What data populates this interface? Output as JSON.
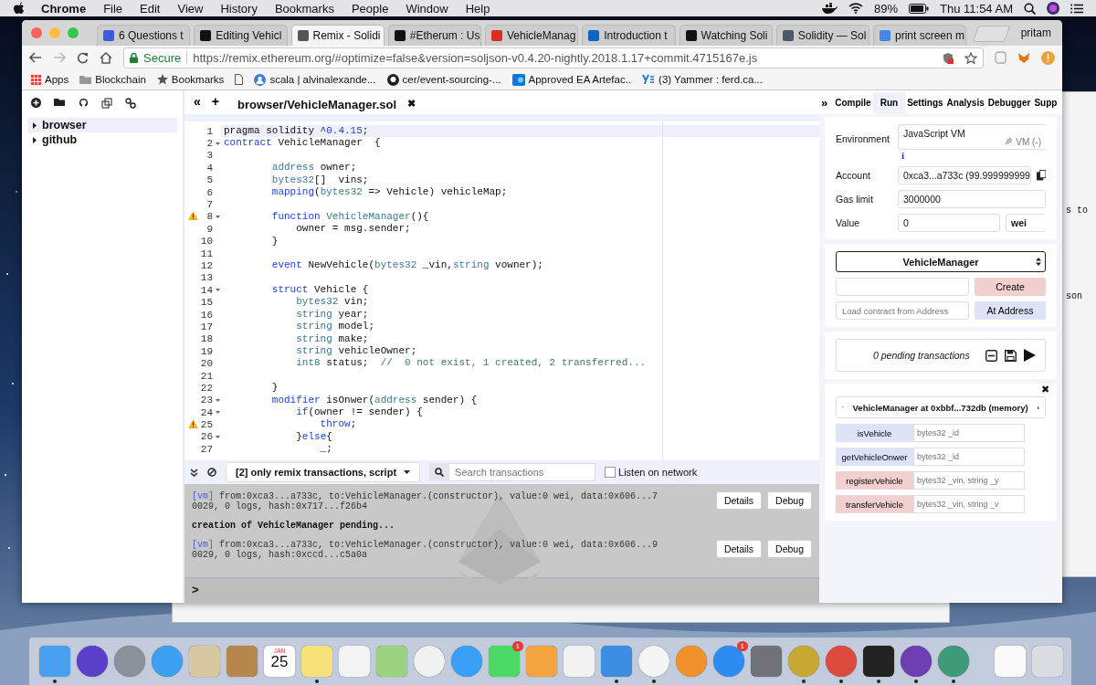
{
  "menubar": {
    "app": "Chrome",
    "menus": [
      "File",
      "Edit",
      "View",
      "History",
      "Bookmarks",
      "People",
      "Window",
      "Help"
    ],
    "battery": "89%",
    "clock": "Thu 11:54 AM"
  },
  "browser": {
    "tabs": [
      {
        "title": "6 Questions t",
        "selected": false,
        "color": "#3b5bdb"
      },
      {
        "title": "Editing Vehicl",
        "selected": false,
        "color": "#111111"
      },
      {
        "title": "Remix - Solidi",
        "selected": true,
        "color": "#555555"
      },
      {
        "title": "#Etherum : Us",
        "selected": false,
        "color": "#111111"
      },
      {
        "title": "VehicleManag",
        "selected": false,
        "color": "#d93025"
      },
      {
        "title": "Introduction t",
        "selected": false,
        "color": "#0a66c2"
      },
      {
        "title": "Watching Soli",
        "selected": false,
        "color": "#111111"
      },
      {
        "title": "Solidity — Sol",
        "selected": false,
        "color": "#4a5a6a"
      },
      {
        "title": "print screen m",
        "selected": false,
        "color": "#4285f4"
      }
    ],
    "profile": "pritam",
    "secure": "Secure",
    "url": "https://remix.ethereum.org/#optimize=false&version=soljson-v0.4.20-nightly.2018.1.17+commit.4715167e.js",
    "bookmarks": [
      {
        "kind": "apps",
        "label": "Apps"
      },
      {
        "kind": "folder",
        "label": "Blockchain"
      },
      {
        "kind": "star",
        "label": "Bookmarks"
      },
      {
        "kind": "page"
      },
      {
        "kind": "avatar",
        "label": "scala | alvinalexande..."
      },
      {
        "kind": "github",
        "label": "cer/event-sourcing-..."
      },
      {
        "kind": "sharepoint",
        "label": "Approved EA Artefac.."
      },
      {
        "kind": "yammer",
        "label": "(3) Yammer : ferd.ca..."
      }
    ]
  },
  "remix": {
    "files": [
      {
        "label": "browser",
        "selected": true
      },
      {
        "label": "github",
        "selected": false
      }
    ],
    "editor": {
      "collapse": "«",
      "add": "+",
      "file": "browser/VehicleManager.sol",
      "close": "✖",
      "lines": [
        {
          "number": "1",
          "warning": false,
          "fold": false,
          "active": true,
          "tokens": [
            {
              "kind": "plain",
              "text": "pragma solidity ^"
            },
            {
              "kind": "number",
              "text": "0.4.15"
            },
            {
              "kind": "plain",
              "text": ";"
            }
          ]
        },
        {
          "number": "2",
          "warning": false,
          "fold": true,
          "active": false,
          "tokens": [
            {
              "kind": "keyword",
              "text": "contract"
            },
            {
              "kind": "plain",
              "text": " VehicleManager  {"
            }
          ]
        },
        {
          "number": "3",
          "warning": false,
          "fold": false,
          "active": false
        },
        {
          "number": "4",
          "warning": false,
          "fold": false,
          "active": false,
          "tokens": [
            {
              "kind": "type",
              "text": "        address"
            },
            {
              "kind": "plain",
              "text": " owner;"
            }
          ]
        },
        {
          "number": "5",
          "warning": false,
          "fold": false,
          "active": false,
          "tokens": [
            {
              "kind": "type",
              "text": "        bytes32"
            },
            {
              "kind": "plain",
              "text": "[]  vins;"
            }
          ]
        },
        {
          "number": "6",
          "warning": false,
          "fold": false,
          "active": false,
          "tokens": [
            {
              "kind": "keyword",
              "text": "        mapping"
            },
            {
              "kind": "plain",
              "text": "("
            },
            {
              "kind": "type",
              "text": "bytes32"
            },
            {
              "kind": "plain",
              "text": " => Vehicle) vehicleMap;"
            }
          ]
        },
        {
          "number": "7",
          "warning": false,
          "fold": false,
          "active": false
        },
        {
          "number": "8",
          "warning": true,
          "fold": true,
          "active": false,
          "tokens": [
            {
              "kind": "keyword",
              "text": "        function"
            },
            {
              "kind": "type",
              "text": " VehicleManager"
            },
            {
              "kind": "plain",
              "text": "(){"
            }
          ]
        },
        {
          "number": "9",
          "warning": false,
          "fold": false,
          "active": false,
          "tokens": [
            {
              "kind": "plain",
              "text": "            owner = msg.sender;"
            }
          ]
        },
        {
          "number": "10",
          "warning": false,
          "fold": false,
          "active": false,
          "tokens": [
            {
              "kind": "plain",
              "text": "        }"
            }
          ]
        },
        {
          "number": "11",
          "warning": false,
          "fold": false,
          "active": false
        },
        {
          "number": "12",
          "warning": false,
          "fold": false,
          "active": false,
          "tokens": [
            {
              "kind": "keyword",
              "text": "        event"
            },
            {
              "kind": "plain",
              "text": " NewVehicle("
            },
            {
              "kind": "type",
              "text": "bytes32"
            },
            {
              "kind": "plain",
              "text": " _vin,"
            },
            {
              "kind": "type",
              "text": "string"
            },
            {
              "kind": "plain",
              "text": " vowner);"
            }
          ]
        },
        {
          "number": "13",
          "warning": false,
          "fold": false,
          "active": false
        },
        {
          "number": "14",
          "warning": false,
          "fold": true,
          "active": false,
          "tokens": [
            {
              "kind": "keyword",
              "text": "        struct"
            },
            {
              "kind": "plain",
              "text": " Vehicle {"
            }
          ]
        },
        {
          "number": "15",
          "warning": false,
          "fold": false,
          "active": false,
          "tokens": [
            {
              "kind": "type",
              "text": "            bytes32"
            },
            {
              "kind": "plain",
              "text": " vin;"
            }
          ]
        },
        {
          "number": "16",
          "warning": false,
          "fold": false,
          "active": false,
          "tokens": [
            {
              "kind": "type",
              "text": "            string"
            },
            {
              "kind": "plain",
              "text": " year;"
            }
          ]
        },
        {
          "number": "17",
          "warning": false,
          "fold": false,
          "active": false,
          "tokens": [
            {
              "kind": "type",
              "text": "            string"
            },
            {
              "kind": "plain",
              "text": " model;"
            }
          ]
        },
        {
          "number": "18",
          "warning": false,
          "fold": false,
          "active": false,
          "tokens": [
            {
              "kind": "type",
              "text": "            string"
            },
            {
              "kind": "plain",
              "text": " make;"
            }
          ]
        },
        {
          "number": "19",
          "warning": false,
          "fold": false,
          "active": false,
          "tokens": [
            {
              "kind": "type",
              "text": "            string"
            },
            {
              "kind": "plain",
              "text": " vehicleOwner;"
            }
          ]
        },
        {
          "number": "20",
          "warning": false,
          "fold": false,
          "active": false,
          "tokens": [
            {
              "kind": "type",
              "text": "            int8"
            },
            {
              "kind": "plain",
              "text": " status;  "
            },
            {
              "kind": "comment",
              "text": "//  0 not exist, 1 created, 2 transferred..."
            }
          ]
        },
        {
          "number": "21",
          "warning": false,
          "fold": false,
          "active": false
        },
        {
          "number": "22",
          "warning": false,
          "fold": false,
          "active": false,
          "tokens": [
            {
              "kind": "plain",
              "text": "        }"
            }
          ]
        },
        {
          "number": "23",
          "warning": false,
          "fold": true,
          "active": false,
          "tokens": [
            {
              "kind": "keyword",
              "text": "        modifier"
            },
            {
              "kind": "plain",
              "text": " isOnwer("
            },
            {
              "kind": "type",
              "text": "address"
            },
            {
              "kind": "plain",
              "text": " sender) {"
            }
          ]
        },
        {
          "number": "24",
          "warning": false,
          "fold": true,
          "active": false,
          "tokens": [
            {
              "kind": "keyword",
              "text": "            if"
            },
            {
              "kind": "plain",
              "text": "(owner != sender) {"
            }
          ]
        },
        {
          "number": "25",
          "warning": true,
          "fold": false,
          "active": false,
          "tokens": [
            {
              "kind": "keyword",
              "text": "                throw"
            },
            {
              "kind": "plain",
              "text": ";"
            }
          ]
        },
        {
          "number": "26",
          "warning": false,
          "fold": true,
          "active": false,
          "tokens": [
            {
              "kind": "plain",
              "text": "            }"
            },
            {
              "kind": "keyword",
              "text": "else"
            },
            {
              "kind": "plain",
              "text": "{"
            }
          ]
        },
        {
          "number": "27",
          "warning": false,
          "fold": false,
          "active": false,
          "tokens": [
            {
              "kind": "plain",
              "text": "                _;"
            }
          ]
        }
      ]
    },
    "panel_expand": "»",
    "panel_tabs": [
      {
        "label": "Compile",
        "selected": false
      },
      {
        "label": "Run",
        "selected": true
      },
      {
        "label": "Settings",
        "selected": false
      },
      {
        "label": "Analysis",
        "selected": false
      },
      {
        "label": "Debugger",
        "selected": false
      },
      {
        "label": "Supp",
        "selected": false
      }
    ],
    "run": {
      "environment": {
        "label": "Environment",
        "value": "JavaScript VM",
        "status": "VM (-)",
        "info": "i"
      },
      "account": {
        "label": "Account",
        "value": "0xca3...a733c (99.999999999"
      },
      "gas_limit": {
        "label": "Gas limit",
        "value": "3000000"
      },
      "value": {
        "label": "Value",
        "value": "0",
        "unit": "wei"
      },
      "contract": "VehicleManager",
      "create": "Create",
      "load_placeholder": "Load contract from Address",
      "at_address": "At Address",
      "pending": "0 pending transactions",
      "instance": {
        "close": "✖",
        "title": "VehicleManager at 0xbbf...732db (memory)",
        "expanded": true,
        "functions": [
          {
            "name": "isVehicle",
            "kind": "call",
            "placeholder": "bytes32 _id"
          },
          {
            "name": "getVehicleOnwer",
            "kind": "call",
            "placeholder": "bytes32 _id"
          },
          {
            "name": "registerVehicle",
            "kind": "transact",
            "placeholder": "bytes32 _vin, string _y"
          },
          {
            "name": "transferVehicle",
            "kind": "transact",
            "placeholder": "bytes32 _vin, string _v"
          }
        ]
      }
    },
    "terminal": {
      "filter": "[2] only remix transactions, script",
      "search_placeholder": "Search transactions",
      "listen": {
        "label": "Listen on network",
        "checked": false
      },
      "entries": [
        {
          "kind": "tx",
          "tag": "[vm]",
          "lines": [
            "from:0xca3...a733c, to:VehicleManager.(constructor), value:0 wei, data:0x606...7",
            "0029, 0 logs, hash:0x717...f26b4"
          ],
          "buttons": [
            "Details",
            "Debug"
          ]
        },
        {
          "kind": "note",
          "text": "creation of VehicleManager pending..."
        },
        {
          "kind": "tx",
          "tag": "[vm]",
          "lines": [
            "from:0xca3...a733c, to:VehicleManager.(constructor), value:0 wei, data:0x606...9",
            "0029, 0 logs, hash:0xccd...c5a0a"
          ],
          "buttons": [
            "Details",
            "Debug"
          ]
        }
      ],
      "prompt": ">"
    }
  },
  "background_window": {
    "lines": [
      "s to",
      "son"
    ]
  },
  "dock": {
    "items": [
      {
        "kind": "square",
        "color": "#4a9ff0",
        "running": true
      },
      {
        "kind": "round",
        "color": "#5b3fc9",
        "running": false
      },
      {
        "kind": "round",
        "color": "#8b919b",
        "running": false
      },
      {
        "kind": "round",
        "color": "#3d9ff0",
        "running": false
      },
      {
        "kind": "square",
        "color": "#d8c8a0",
        "running": false
      },
      {
        "kind": "square",
        "color": "#b5874d",
        "running": false
      },
      {
        "kind": "calendar",
        "month": "JAN",
        "day": "25",
        "color": "#ffffff",
        "running": false
      },
      {
        "kind": "square",
        "color": "#f7e27a",
        "running": true
      },
      {
        "kind": "square",
        "color": "#f4f4f4",
        "running": false
      },
      {
        "kind": "square",
        "color": "#9ad27f",
        "running": false
      },
      {
        "kind": "round",
        "color": "#f1f1f1",
        "running": false
      },
      {
        "kind": "round",
        "color": "#38a0f6",
        "running": false
      },
      {
        "kind": "square",
        "color": "#4cd964",
        "running": false,
        "badge": "1"
      },
      {
        "kind": "square",
        "color": "#f3a33f",
        "running": false
      },
      {
        "kind": "square",
        "color": "#f2f2f2",
        "running": false
      },
      {
        "kind": "square",
        "color": "#3c8fe0",
        "running": true
      },
      {
        "kind": "round",
        "color": "#f5f5f5",
        "running": true
      },
      {
        "kind": "round",
        "color": "#f0902a",
        "running": false
      },
      {
        "kind": "round",
        "color": "#2d8cf0",
        "running": false,
        "badge": "1"
      },
      {
        "kind": "square",
        "color": "#6f7378",
        "running": false
      },
      {
        "kind": "round",
        "color": "#c8a830",
        "running": true
      },
      {
        "kind": "round",
        "color": "#dd4b3e",
        "running": true
      },
      {
        "kind": "square",
        "color": "#222222",
        "running": true
      },
      {
        "kind": "round",
        "color": "#6e3fb3",
        "running": true
      },
      {
        "kind": "round",
        "color": "#3f9a78",
        "running": true
      },
      {
        "kind": "separator"
      },
      {
        "kind": "square",
        "color": "#fafafa",
        "running": false
      },
      {
        "kind": "square",
        "color": "#d9dde2",
        "running": false
      }
    ]
  }
}
